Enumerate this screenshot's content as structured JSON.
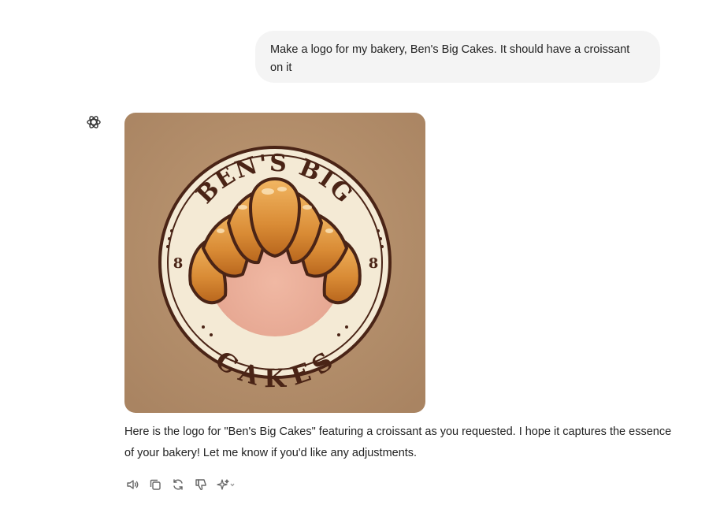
{
  "user_message": {
    "text": "Make a logo for my bakery, Ben's Big Cakes. It should have a croissant on it"
  },
  "assistant": {
    "avatar_icon": "openai-logo-icon",
    "image": {
      "top_text": "BEN'S BIG",
      "bottom_text": "CAKES",
      "left_mark": "8",
      "right_mark": "8",
      "background_color": "#b5906c",
      "badge_color": "#f4ead5",
      "outline_color": "#4a2416"
    },
    "message": "Here is the logo for \"Ben's Big Cakes\" featuring a croissant as you requested. I hope it captures the essence of your bakery! Let me know if you'd like any adjustments."
  },
  "actions": [
    {
      "name": "read-aloud-icon"
    },
    {
      "name": "copy-icon"
    },
    {
      "name": "regenerate-icon"
    },
    {
      "name": "thumbs-down-icon"
    },
    {
      "name": "sparkle-model-icon"
    }
  ]
}
